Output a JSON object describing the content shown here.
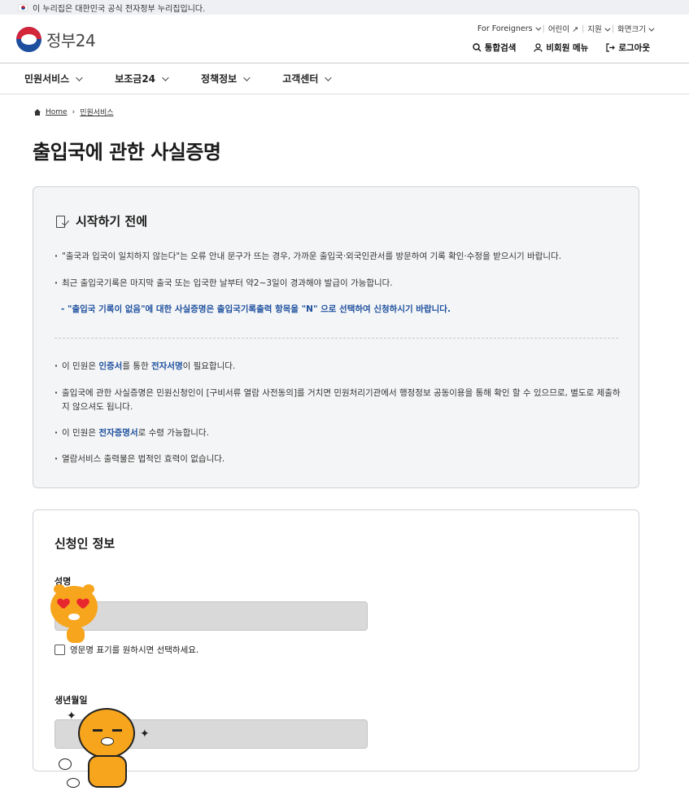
{
  "gov_banner": {
    "text": "이 누리집은 대한민국 공식 전자정부 누리집입니다."
  },
  "header": {
    "logo_text": "정부24",
    "util_top": [
      "For Foreigners",
      "어린이",
      "지원",
      "화면크기"
    ],
    "util_bottom": [
      "통합검색",
      "비회원 메뉴",
      "로그아웃"
    ]
  },
  "gnb": [
    "민원서비스",
    "보조금24",
    "정책정보",
    "고객센터"
  ],
  "breadcrumb": {
    "home": "Home",
    "current": "민원서비스"
  },
  "page_title": "출입국에 관한 사실증명",
  "notice": {
    "title": "시작하기 전에",
    "item1": "\"출국과 입국이 일치하지 않는다\"는 오류 안내 문구가 뜨는 경우, 가까운 출입국·외국인관서를 방문하여 기록 확인·수정을 받으시기 바랍니다.",
    "item2": "최근 출입국기록은 마지막 출국 또는 입국한 날부터 약2~3일이 경과해야 발급이 가능합니다.",
    "sub_note": "- \"출입국 기록이 없음\"에 대한 사실증명은 출입국기록출력 항목을 \"N\" 으로 선택하여 신청하시기 바랍니다.",
    "item3_pre": "이 민원은 ",
    "item3_hl1": "인증서",
    "item3_mid": "를 통한 ",
    "item3_hl2": "전자서명",
    "item3_post": "이 필요합니다.",
    "item4": "출입국에 관한 사실증명은 민원신청인이 [구비서류 열람 사전동의]를 거치면 민원처리기관에서 행정정보 공동이용을 통해 확인 할 수 있으므로, 별도로 제출하지 않으셔도 됩니다.",
    "item5_pre": "이 민원은 ",
    "item5_hl": "전자증명서",
    "item5_post": "로 수령 가능합니다.",
    "item6": "열람서비스 출력물은 법적인 효력이 없습니다."
  },
  "applicant": {
    "title": "신청인 정보",
    "name_label": "성명",
    "name_value": "",
    "english_checkbox_label": "영문명 표기를 원하시면 선택하세요.",
    "english_checked": false,
    "birth_label": "생년월일",
    "birth_value": ""
  },
  "colors": {
    "accent": "#1d4f9e",
    "sticker": "#f7a51c",
    "heart": "#e8262e"
  },
  "icons": [
    "search-icon",
    "user-icon",
    "logout-icon",
    "home-icon",
    "notice-checklist-icon",
    "external-link-icon"
  ]
}
